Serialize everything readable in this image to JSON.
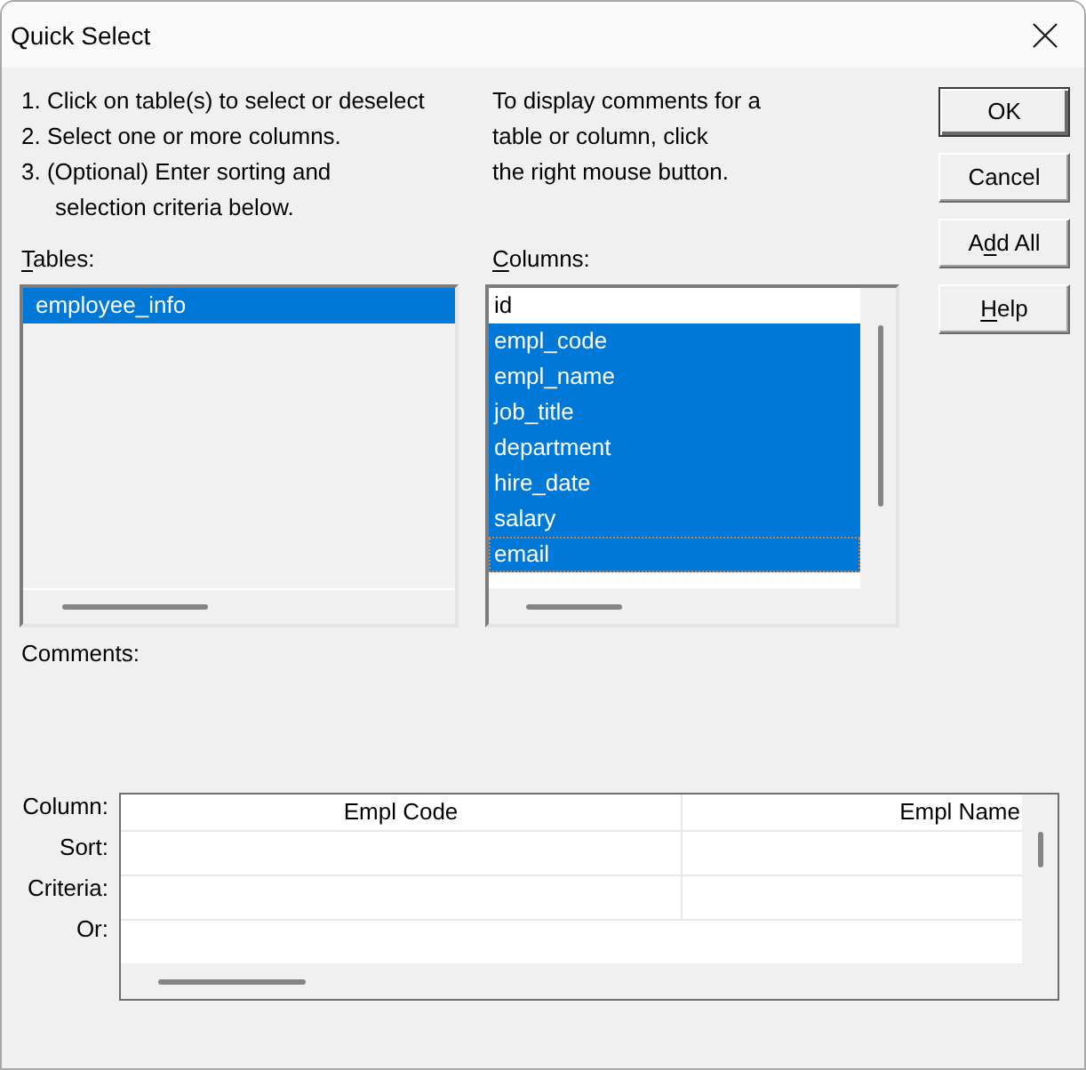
{
  "window": {
    "title": "Quick Select"
  },
  "instructions": [
    {
      "lines": [
        "1. Click on table(s) to select or deselect"
      ]
    },
    {
      "lines": [
        "2. Select one or more columns."
      ]
    },
    {
      "lines": [
        "3. (Optional) Enter sorting and",
        "selection criteria below."
      ]
    }
  ],
  "comment_hint": {
    "lines": [
      "To display comments for a",
      "table or column, click",
      "the right mouse button."
    ]
  },
  "tables": {
    "label_parts": [
      {
        "text": "T",
        "underlined": true
      },
      {
        "text": "ables:",
        "underlined": false
      }
    ],
    "items": [
      {
        "name": "employee_info",
        "selected": true,
        "focused": false
      }
    ]
  },
  "columns": {
    "label_parts": [
      {
        "text": "C",
        "underlined": true
      },
      {
        "text": "olumns:",
        "underlined": false
      }
    ],
    "items": [
      {
        "name": "id",
        "selected": false,
        "focused": false
      },
      {
        "name": "empl_code",
        "selected": true,
        "focused": false
      },
      {
        "name": "empl_name",
        "selected": true,
        "focused": false
      },
      {
        "name": "job_title",
        "selected": true,
        "focused": false
      },
      {
        "name": "department",
        "selected": true,
        "focused": false
      },
      {
        "name": "hire_date",
        "selected": true,
        "focused": false
      },
      {
        "name": "salary",
        "selected": true,
        "focused": false
      },
      {
        "name": "email",
        "selected": true,
        "focused": true
      }
    ]
  },
  "buttons": [
    {
      "label_parts": [
        {
          "text": "OK",
          "underlined": false
        }
      ],
      "default": true
    },
    {
      "label_parts": [
        {
          "text": "Cancel",
          "underlined": false
        }
      ],
      "default": false
    },
    {
      "label_parts": [
        {
          "text": "A",
          "underlined": false
        },
        {
          "text": "d",
          "underlined": true
        },
        {
          "text": "d All",
          "underlined": false
        }
      ],
      "default": false
    },
    {
      "label_parts": [
        {
          "text": "H",
          "underlined": true
        },
        {
          "text": "elp",
          "underlined": false
        }
      ],
      "default": false
    }
  ],
  "comments": {
    "label": "Comments:"
  },
  "criteria_grid": {
    "row_labels": [
      "Column:",
      "Sort:",
      "Criteria:",
      "Or:"
    ],
    "columns": [
      "Empl Code",
      "Empl Name"
    ]
  }
}
